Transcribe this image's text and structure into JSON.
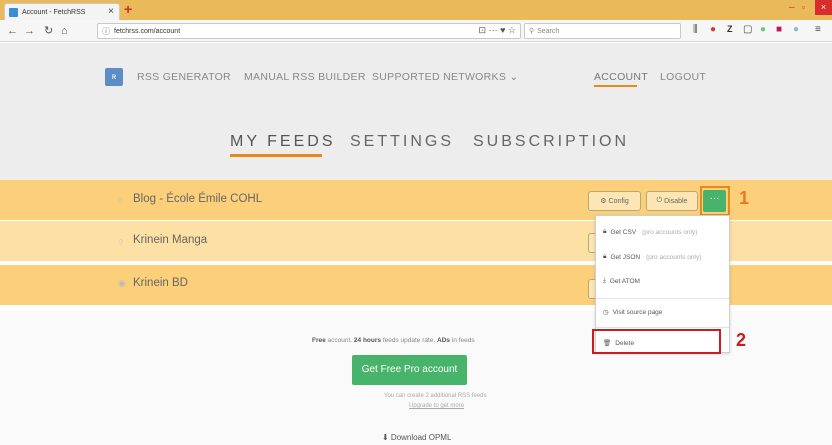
{
  "browser": {
    "tab_title": "Account - FetchRSS",
    "tab_close": "×",
    "new_tab": "+",
    "url": "fetchrss.com/account",
    "search_placeholder": "Search",
    "url_tools": "⊡ ··· ♥ ☆",
    "window": {
      "min": "–",
      "max": "▫",
      "close": "×"
    }
  },
  "nav": {
    "items": [
      {
        "label": "RSS GENERATOR"
      },
      {
        "label": "MANUAL RSS BUILDER"
      },
      {
        "label": "SUPPORTED NETWORKS ⌄"
      }
    ],
    "account": "ACCOUNT",
    "logout": "LOGOUT"
  },
  "subnav": {
    "my_feeds": "MY FEEDS",
    "settings": "SETTINGS",
    "subscription": "SUBSCRIPTION"
  },
  "feeds": [
    {
      "name": "Blog - École Émile COHL",
      "radio": "○"
    },
    {
      "name": "Krinein Manga",
      "radio": "○"
    },
    {
      "name": "Krinein BD",
      "radio": "◉"
    }
  ],
  "actions": {
    "config": "Config",
    "disable": "Disable",
    "more": "···"
  },
  "dropdown": {
    "csv": "Get CSV",
    "csv_hint": "(pro accounts only)",
    "json": "Get JSON",
    "json_hint": "(pro accounts only)",
    "atom": "Get ATOM",
    "visit": "Visit source page",
    "delete": "Delete"
  },
  "steps": {
    "one": "1",
    "two": "2"
  },
  "plan": {
    "free": "Free",
    "prefix": " account. ",
    "hours": "24 hours",
    "middle": " feeds update rate. ",
    "ads": "ADs",
    "suffix": " in feeds",
    "pro_button": "Get Free Pro account",
    "note": "You can create 2 additional RSS feeds",
    "upgrade": "Upgrade to get more",
    "opml": "⬇ Download OPML"
  },
  "colors": {
    "accent": "#e88a1a",
    "green": "#48b36a",
    "row": "#fccf7a",
    "step2": "#c91d1d"
  }
}
